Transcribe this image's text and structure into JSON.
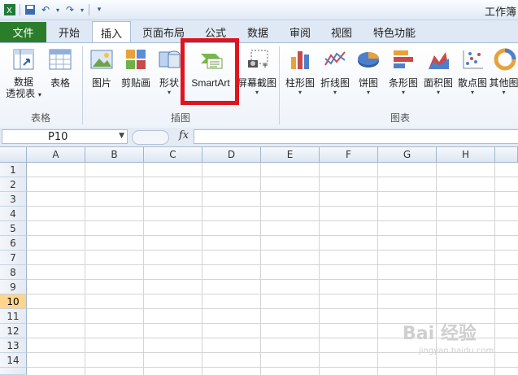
{
  "window": {
    "title": "工作簿"
  },
  "ribbon_tabs": [
    {
      "label": "文件"
    },
    {
      "label": "开始"
    },
    {
      "label": "插入"
    },
    {
      "label": "页面布局"
    },
    {
      "label": "公式"
    },
    {
      "label": "数据"
    },
    {
      "label": "审阅"
    },
    {
      "label": "视图"
    },
    {
      "label": "特色功能"
    }
  ],
  "groups": {
    "tables": "表格",
    "illustrations": "插图",
    "charts": "图表"
  },
  "buttons": {
    "pivot1": "数据",
    "pivot2": "透视表",
    "table": "表格",
    "picture": "图片",
    "clipart": "剪贴画",
    "shapes": "形状",
    "smartart": "SmartArt",
    "screenshot": "屏幕截图",
    "column": "柱形图",
    "line": "折线图",
    "pie": "饼图",
    "bar": "条形图",
    "area": "面积图",
    "scatter": "散点图",
    "other": "其他图"
  },
  "formula_bar": {
    "name_box": "P10",
    "fx": "fx"
  },
  "columns": [
    "A",
    "B",
    "C",
    "D",
    "E",
    "F",
    "G",
    "H"
  ],
  "rows": [
    "1",
    "2",
    "3",
    "4",
    "5",
    "6",
    "7",
    "8",
    "9",
    "10",
    "11",
    "12",
    "13",
    "14"
  ],
  "selected_row": "10",
  "watermark": {
    "main": "Bai 经验",
    "sub": "jingyan.baidu.com"
  },
  "colors": {
    "file_tab": "#2b7c2b",
    "highlight": "#e0141e",
    "selected_row": "#ffd58d"
  }
}
